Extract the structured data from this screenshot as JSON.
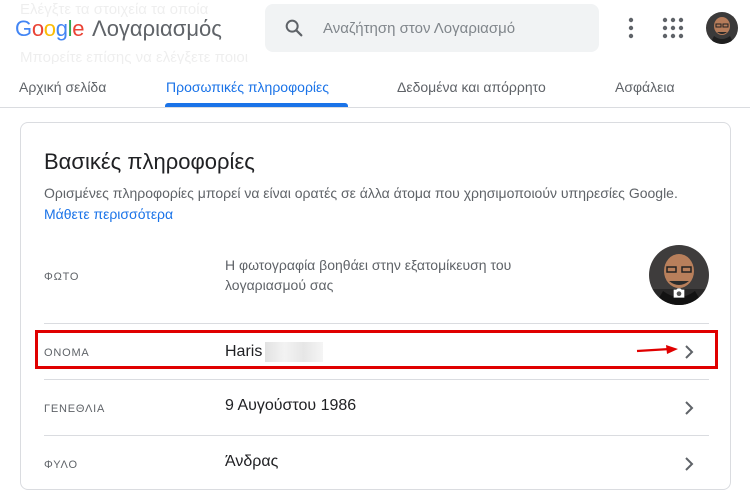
{
  "header": {
    "logo_word": "Google",
    "logo_subtitle": "Λογαριασμός",
    "search_placeholder": "Αναζήτηση στον Λογαριασμό",
    "ghost_line_1": "Ελέγξτε τα στοιχεία τα οποία",
    "ghost_line_2": "Μπορείτε επίσης να ελέγξετε ποιοι"
  },
  "tabs": [
    {
      "label": "Αρχική σελίδα",
      "active": false
    },
    {
      "label": "Προσωπικές πληροφορίες",
      "active": true
    },
    {
      "label": "Δεδομένα και απόρρητο",
      "active": false
    },
    {
      "label": "Ασφάλεια",
      "active": false
    }
  ],
  "card": {
    "title": "Βασικές πληροφορίες",
    "description": "Ορισμένες πληροφορίες μπορεί να είναι ορατές σε άλλα άτομα που χρησιμοποιούν υπηρεσίες Google.",
    "learn_more": "Μάθετε περισσότερα",
    "rows": [
      {
        "label": "ΦΩΤΟ",
        "value": "Η φωτογραφία βοηθάει στην εξατομίκευση του λογαριασμού σας"
      },
      {
        "label": "ΟΝΟΜΑ",
        "value": "Haris"
      },
      {
        "label": "ΓΕΝΕΘΛΙΑ",
        "value": "9 Αυγούστου 1986"
      },
      {
        "label": "ΦΥΛΟ",
        "value": "Άνδρας"
      }
    ]
  },
  "colors": {
    "accent": "#1a73e8",
    "highlight": "#e00000",
    "divider": "#dadce0"
  },
  "icons": [
    "search-icon",
    "kebab-menu-icon",
    "apps-grid-icon",
    "avatar",
    "camera-icon",
    "chevron-right-icon",
    "red-arrow-annotation"
  ]
}
